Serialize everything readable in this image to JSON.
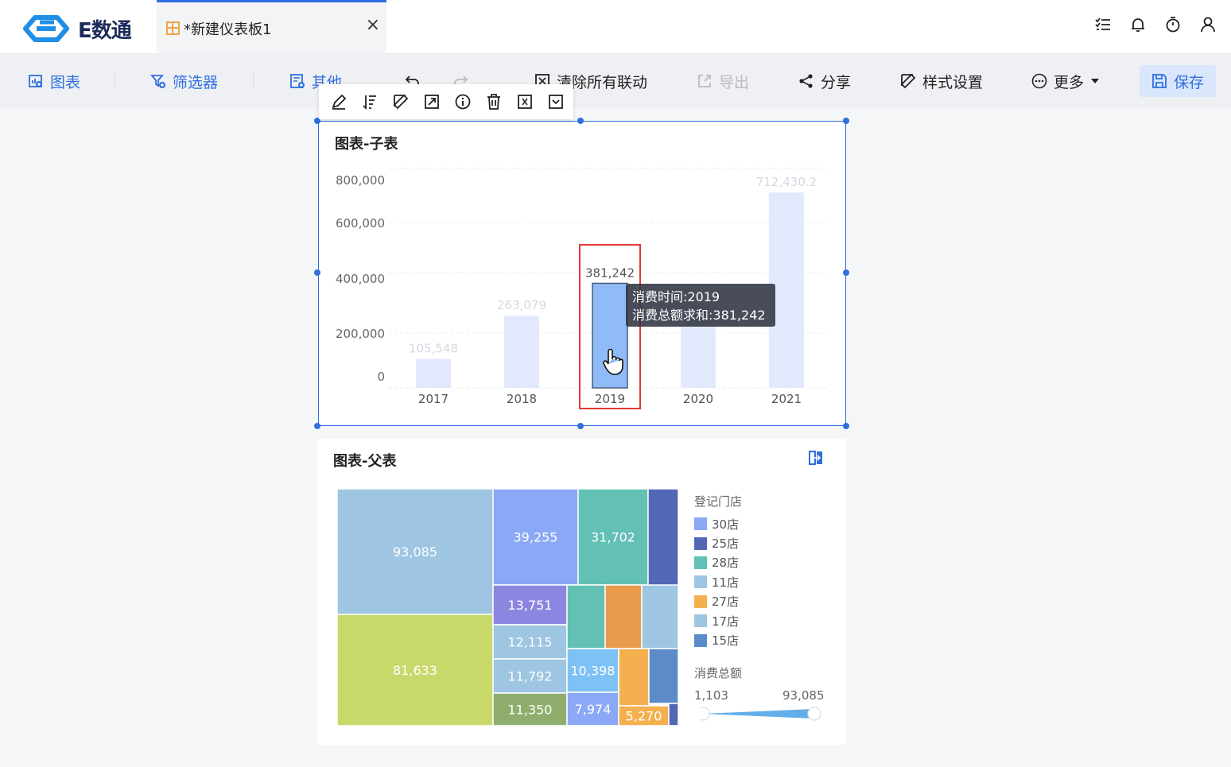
{
  "app": {
    "logo_text": "E数通"
  },
  "tab": {
    "title": "*新建仪表板1",
    "close": "×"
  },
  "toolbar": {
    "chart": "图表",
    "filter": "筛选器",
    "other": "其他",
    "clear_links": "清除所有联动",
    "export": "导出",
    "share": "分享",
    "style": "样式设置",
    "more": "更多",
    "save": "保存"
  },
  "child_chart": {
    "title": "图表-子表",
    "tooltip": {
      "line1": "消费时间:2019",
      "line2": "消费总额求和:381,242"
    }
  },
  "parent_chart": {
    "title": "图表-父表",
    "legend_title": "登记门店",
    "legend": [
      {
        "label": "30店",
        "color": "#8aa8f5"
      },
      {
        "label": "25店",
        "color": "#5467b6"
      },
      {
        "label": "28店",
        "color": "#62c0b5"
      },
      {
        "label": "11店",
        "color": "#9ec5e2"
      },
      {
        "label": "27店",
        "color": "#f4b04f"
      },
      {
        "label": "17店",
        "color": "#9ec5e2"
      },
      {
        "label": "15店",
        "color": "#5b8cc7"
      }
    ],
    "range_title": "消费总额",
    "range_min": "1,103",
    "range_max": "93,085"
  },
  "chart_data": [
    {
      "type": "bar",
      "title": "图表-子表",
      "categories": [
        "2017",
        "2018",
        "2019",
        "2020",
        "2021"
      ],
      "values": [
        105548,
        263079,
        381242,
        300000,
        712430.2
      ],
      "data_labels": [
        "105,548",
        "263,079",
        "381,242",
        "",
        "712,430.2"
      ],
      "highlight_index": 2,
      "ylim": [
        0,
        800000
      ],
      "yticks": [
        "800,000",
        "600,000",
        "400,000",
        "200,000",
        "0"
      ],
      "colors": {
        "normal": "#e3e9fd",
        "highlight": "#8fbcf8"
      }
    },
    {
      "type": "treemap",
      "title": "图表-父表",
      "cells": [
        {
          "value": "93,085",
          "color": "#9ec5e2"
        },
        {
          "value": "81,633",
          "color": "#c9d86a"
        },
        {
          "value": "39,255",
          "color": "#8aa8f5"
        },
        {
          "value": "31,702",
          "color": "#62c0b5"
        },
        {
          "value": "",
          "color": "#5467b6"
        },
        {
          "value": "13,751",
          "color": "#8c86e0"
        },
        {
          "value": "12,115",
          "color": "#9ec5e2"
        },
        {
          "value": "11,792",
          "color": "#9ec5e2"
        },
        {
          "value": "11,350",
          "color": "#8fae6e"
        },
        {
          "value": "",
          "color": "#62c0b5"
        },
        {
          "value": "",
          "color": "#e99a4b"
        },
        {
          "value": "",
          "color": "#9ec5e2"
        },
        {
          "value": "10,398",
          "color": "#7ec1f5"
        },
        {
          "value": "",
          "color": "#f4b04f"
        },
        {
          "value": "",
          "color": "#5b8cc7"
        },
        {
          "value": "7,974",
          "color": "#8aa8f5"
        },
        {
          "value": "5,270",
          "color": "#f4b04f"
        },
        {
          "value": "",
          "color": "#5467b6"
        }
      ]
    }
  ]
}
